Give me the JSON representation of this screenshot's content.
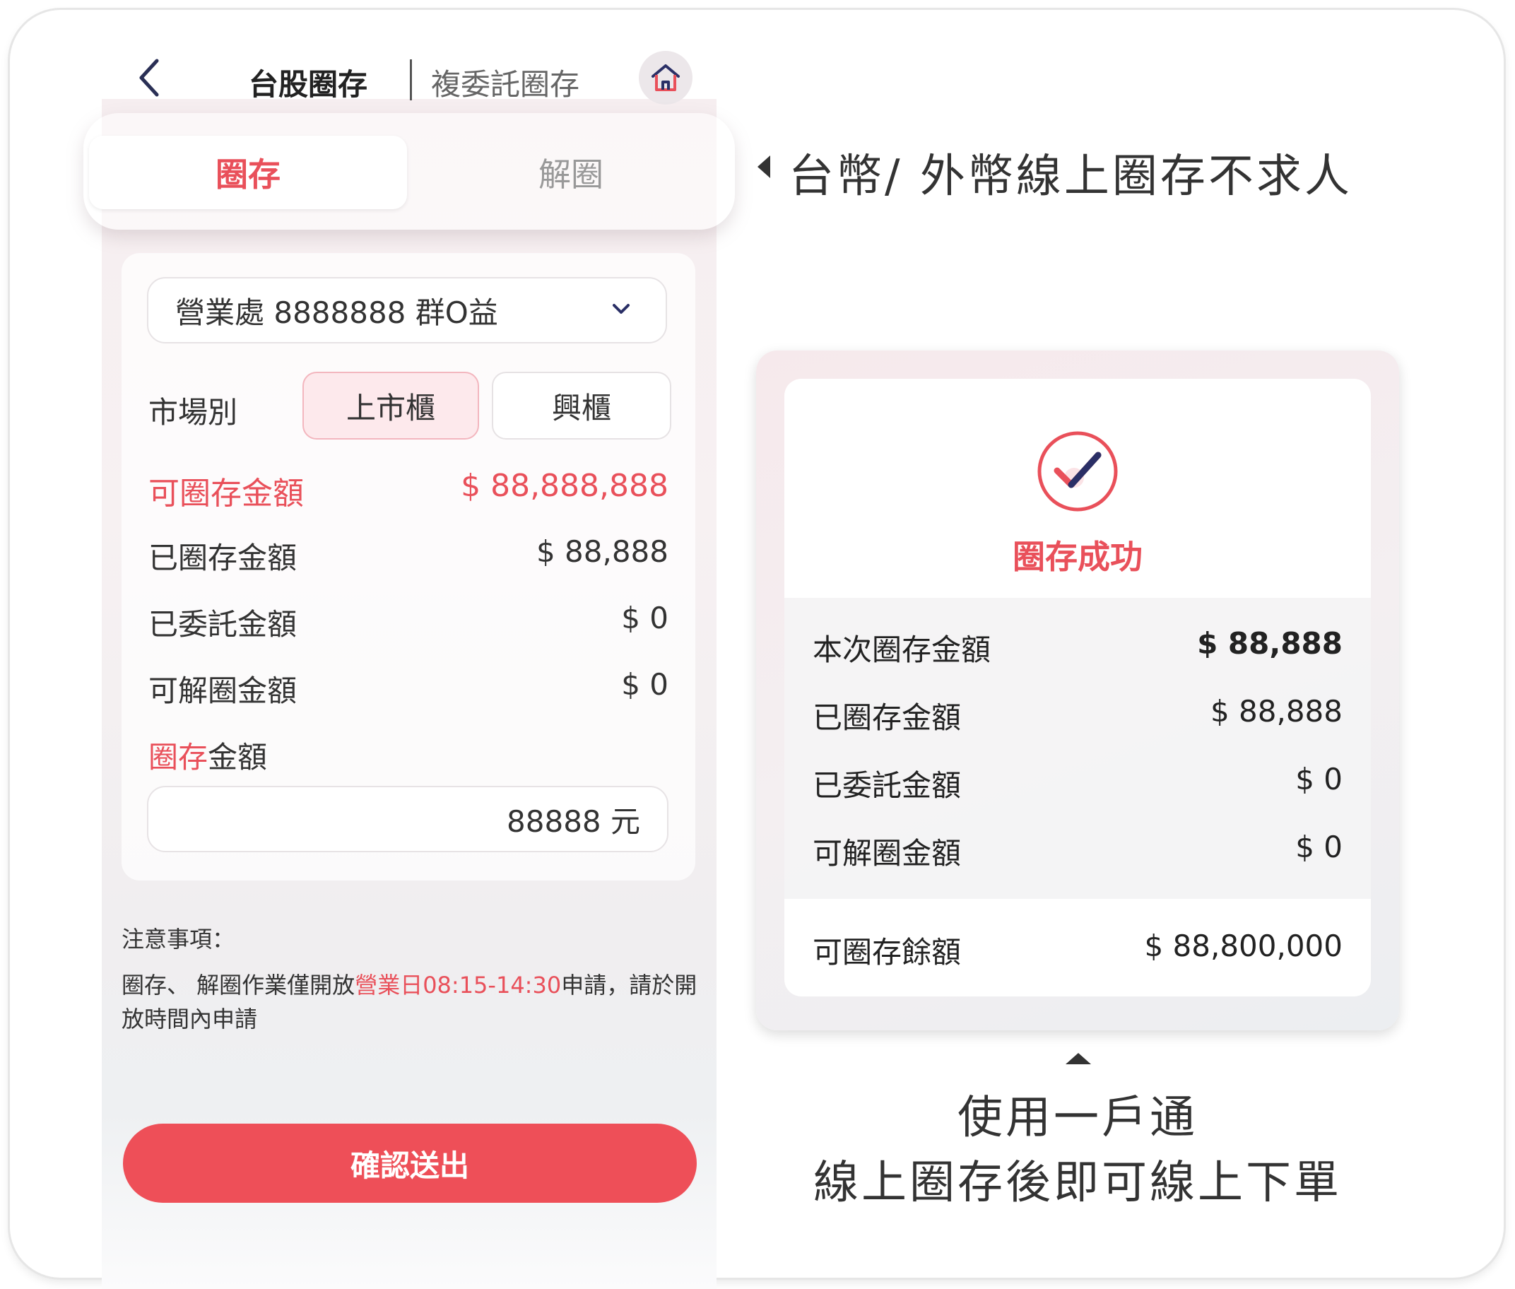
{
  "header": {
    "tab_main": "台股圈存",
    "tab_sub": "複委託圈存"
  },
  "segment": {
    "active": "圈存",
    "inactive": "解圈"
  },
  "form": {
    "account": "營業處 8888888 群O益",
    "market_label": "市場別",
    "market_options": [
      "上市櫃",
      "興櫃"
    ],
    "rows": [
      {
        "label": "可圈存金額",
        "value": "$ 88,888,888"
      },
      {
        "label": "已圈存金額",
        "value": "$ 88,888"
      },
      {
        "label": "已委託金額",
        "value": "$ 0"
      },
      {
        "label": "可解圈金額",
        "value": "$ 0"
      }
    ],
    "amount_label_red": "圈存",
    "amount_label_rest": "金額",
    "amount_value": "88888 元"
  },
  "notice": {
    "title": "注意事項：",
    "text_before": "圈存、 解圈作業僅開放",
    "text_red": "營業日08:15-14:30",
    "text_after": "申請，請於開放時間內申請"
  },
  "submit_label": "確認送出",
  "caption_top": "台幣/ 外幣線上圈存不求人",
  "result": {
    "status": "圈存成功",
    "rows": [
      {
        "label": "本次圈存金額",
        "value": "$ 88,888"
      },
      {
        "label": "已圈存金額",
        "value": "$ 88,888"
      },
      {
        "label": "已委託金額",
        "value": "$ 0"
      },
      {
        "label": "可解圈金額",
        "value": "$ 0"
      }
    ],
    "balance_label": "可圈存餘額",
    "balance_value": "$ 88,800,000"
  },
  "caption_bottom": [
    "使用一戶通",
    "線上圈存後即可線上下單"
  ],
  "colors": {
    "accent": "#e9505a",
    "button": "#ee4f58"
  }
}
